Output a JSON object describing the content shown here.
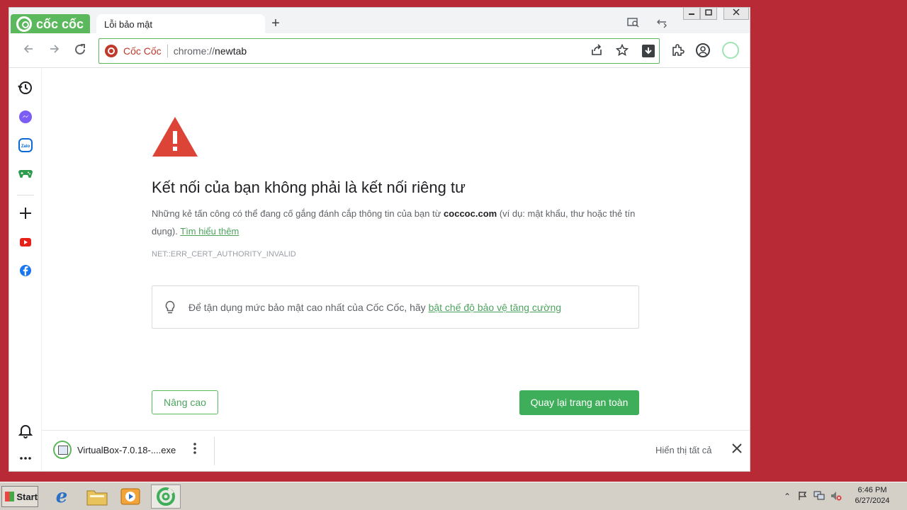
{
  "browser": {
    "logo_text": "cốc cốc",
    "tab_title": "Lỗi bảo mật",
    "new_tab_symbol": "+",
    "omnibox": {
      "site_name": "Cốc Cốc",
      "url_prefix": "chrome://",
      "url_host": "newtab"
    }
  },
  "page": {
    "title": "Kết nối của bạn không phải là kết nối riêng tư",
    "desc_part1": "Những kẻ tấn công có thể đang cố gắng đánh cắp thông tin của bạn từ ",
    "desc_domain": "coccoc.com",
    "desc_part2": " (ví dụ: mật khẩu, thư hoặc thẻ tín dụng). ",
    "learn_more": "Tìm hiểu thêm",
    "error_code": "NET::ERR_CERT_AUTHORITY_INVALID",
    "tip_text": "Để tận dụng mức bảo mật cao nhất của Cốc Cốc, hãy ",
    "tip_link": "bật chế độ bảo vệ tăng cường",
    "advanced_button": "Nâng cao",
    "back_button": "Quay lại trang an toàn"
  },
  "download_bar": {
    "file_name": "VirtualBox-7.0.18-....exe",
    "show_all": "Hiển thị tất cả"
  },
  "taskbar": {
    "start_label": "Start",
    "time": "6:46 PM",
    "date": "6/27/2024"
  },
  "colors": {
    "brand_green": "#5cb85c",
    "button_green": "#3fae5a",
    "warning_red": "#db4437",
    "desktop": "#b82a36"
  }
}
